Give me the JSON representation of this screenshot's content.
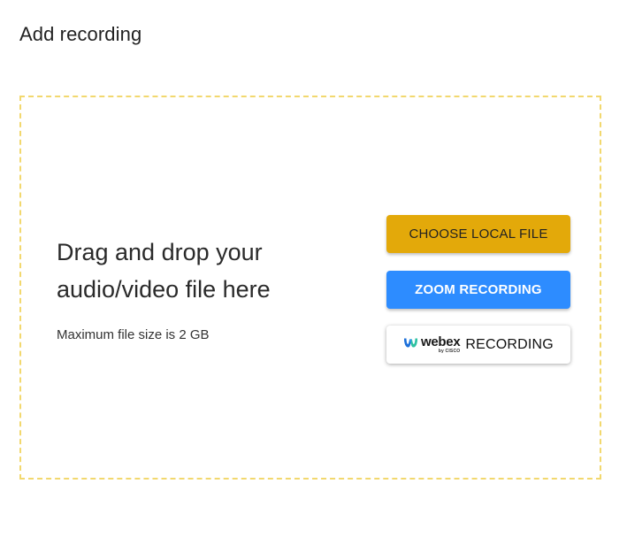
{
  "page": {
    "title": "Add recording"
  },
  "dropzone": {
    "heading": "Drag and drop your audio/video file here",
    "max_size_text": "Maximum file size is 2 GB",
    "border_color": "#f2d86e"
  },
  "buttons": {
    "local_file": {
      "label": "CHOOSE LOCAL FILE",
      "color": "#e3a90a"
    },
    "zoom": {
      "label": "ZOOM RECORDING",
      "color": "#2d8cff"
    },
    "webex": {
      "brand": "webex",
      "brand_by": "by CISCO",
      "label": "RECORDING",
      "logo_icon": "webex-logo-icon"
    }
  }
}
